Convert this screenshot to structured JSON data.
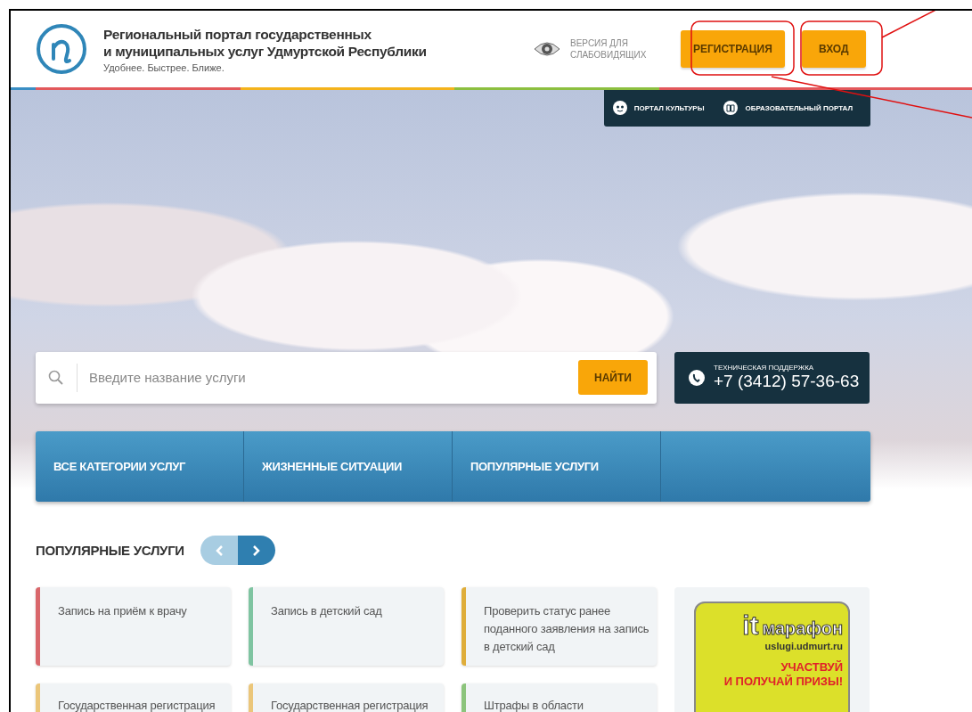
{
  "header": {
    "title_line_1": "Региональный портал государственных",
    "title_line_2": "и муниципальных услуг Удмуртской Республики",
    "tagline": "Удобнее. Быстрее. Ближе.",
    "accessibility_link": "ВЕРСИЯ ДЛЯ СЛАБОВИДЯЩИХ",
    "buttons": [
      {
        "label": "РЕГИСТРАЦИЯ",
        "annotated": true
      },
      {
        "label": "ВХОД",
        "annotated": true
      }
    ]
  },
  "portal_links": [
    {
      "kind": "culture",
      "label": "ПОРТАЛ КУЛЬТУРЫ"
    },
    {
      "kind": "education",
      "label": "ОБРАЗОВАТЕЛЬНЫЙ ПОРТАЛ"
    }
  ],
  "search": {
    "placeholder": "Введите название услуги",
    "button": "НАЙТИ"
  },
  "support": {
    "label": "ТЕХНИЧЕСКАЯ ПОДДЕРЖКА",
    "phone": "+7 (3412) 57-36-63"
  },
  "nav_tabs": [
    "ВСЕ КАТЕГОРИИ УСЛУГ",
    "ЖИЗНЕННЫЕ СИТУАЦИИ",
    "ПОПУЛЯРНЫЕ УСЛУГИ"
  ],
  "popular": {
    "title": "ПОПУЛЯРНЫЕ УСЛУГИ",
    "services": [
      {
        "text": "Запись на приём к врачу",
        "color": "#d9676b"
      },
      {
        "text": "Запись в детский сад",
        "color": "#7fc4a1"
      },
      {
        "text": "Проверить статус ранее поданного заявления на запись в детский сад",
        "color": "#dfad3a"
      },
      {
        "text": "Государственная регистрация",
        "color": "#ebc67a"
      },
      {
        "text": "Государственная регистрация",
        "color": "#ebc67a"
      },
      {
        "text": "Штрафы в области",
        "color": "#8cc47c"
      }
    ],
    "banner": {
      "logo_it": "it",
      "logo_word": "марафон",
      "url": "uslugi.udmurt.ru",
      "slogan_1": "УЧАСТВУЙ",
      "slogan_2": "И ПОЛУЧАЙ ПРИЗЫ!"
    }
  }
}
